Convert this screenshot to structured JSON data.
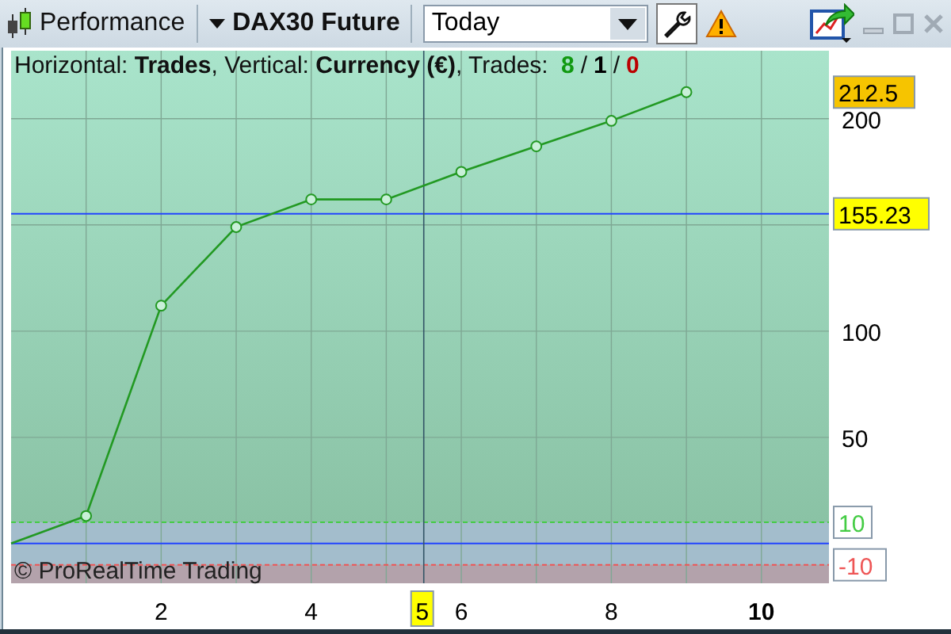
{
  "toolbar": {
    "indicator": "Performance",
    "instrument": "DAX30 Future",
    "period": {
      "value": "Today"
    }
  },
  "chart": {
    "heading": "Horizontal: **Trades**, Vertical: **Currency (€)**, Trades: ",
    "trade_counts": [
      {
        "label": "8",
        "color": "#119911"
      },
      {
        "label": "1",
        "color": "#000000"
      },
      {
        "label": "0",
        "color": "#bb0000"
      }
    ],
    "count_separator": "/",
    "copyright": "© ProRealTime Trading",
    "chart_data": {
      "type": "line",
      "x": [
        0,
        1,
        2,
        3,
        4,
        5,
        6,
        7,
        8,
        9
      ],
      "series": [
        {
          "color": "#229922",
          "marker": "o",
          "values": [
            0,
            13,
            112,
            149,
            162,
            162,
            175,
            187,
            199,
            212.5
          ]
        }
      ],
      "xlim": [
        0,
        10.9
      ],
      "ylim": [
        -18.7,
        232
      ],
      "xticks": [
        2,
        4,
        6,
        8,
        {
          "value": 10,
          "label": "10"
        }
      ],
      "yticks": [
        50,
        100,
        200
      ],
      "grid": true,
      "ref_lines": [
        {
          "axis": "y",
          "value": 155.23,
          "color": "#2244ff",
          "label": "155.23"
        },
        {
          "axis": "y",
          "value": 0,
          "color": "#2244ff"
        },
        {
          "axis": "y",
          "value": 10,
          "color": "#44cc44",
          "label": "10"
        },
        {
          "axis": "y",
          "value": -10,
          "color": "#ee5555",
          "label": "-10"
        },
        {
          "axis": "x",
          "value": 5.5,
          "color": "#335566",
          "label": "5"
        }
      ],
      "bands": [
        {
          "axis": "y",
          "from": -10,
          "to": 10,
          "color": "#a3bdcc"
        },
        {
          "axis": "y",
          "from": -18.7,
          "to": -10,
          "color": "#b3a2ab"
        }
      ],
      "annotations": [
        "212.5"
      ]
    }
  }
}
